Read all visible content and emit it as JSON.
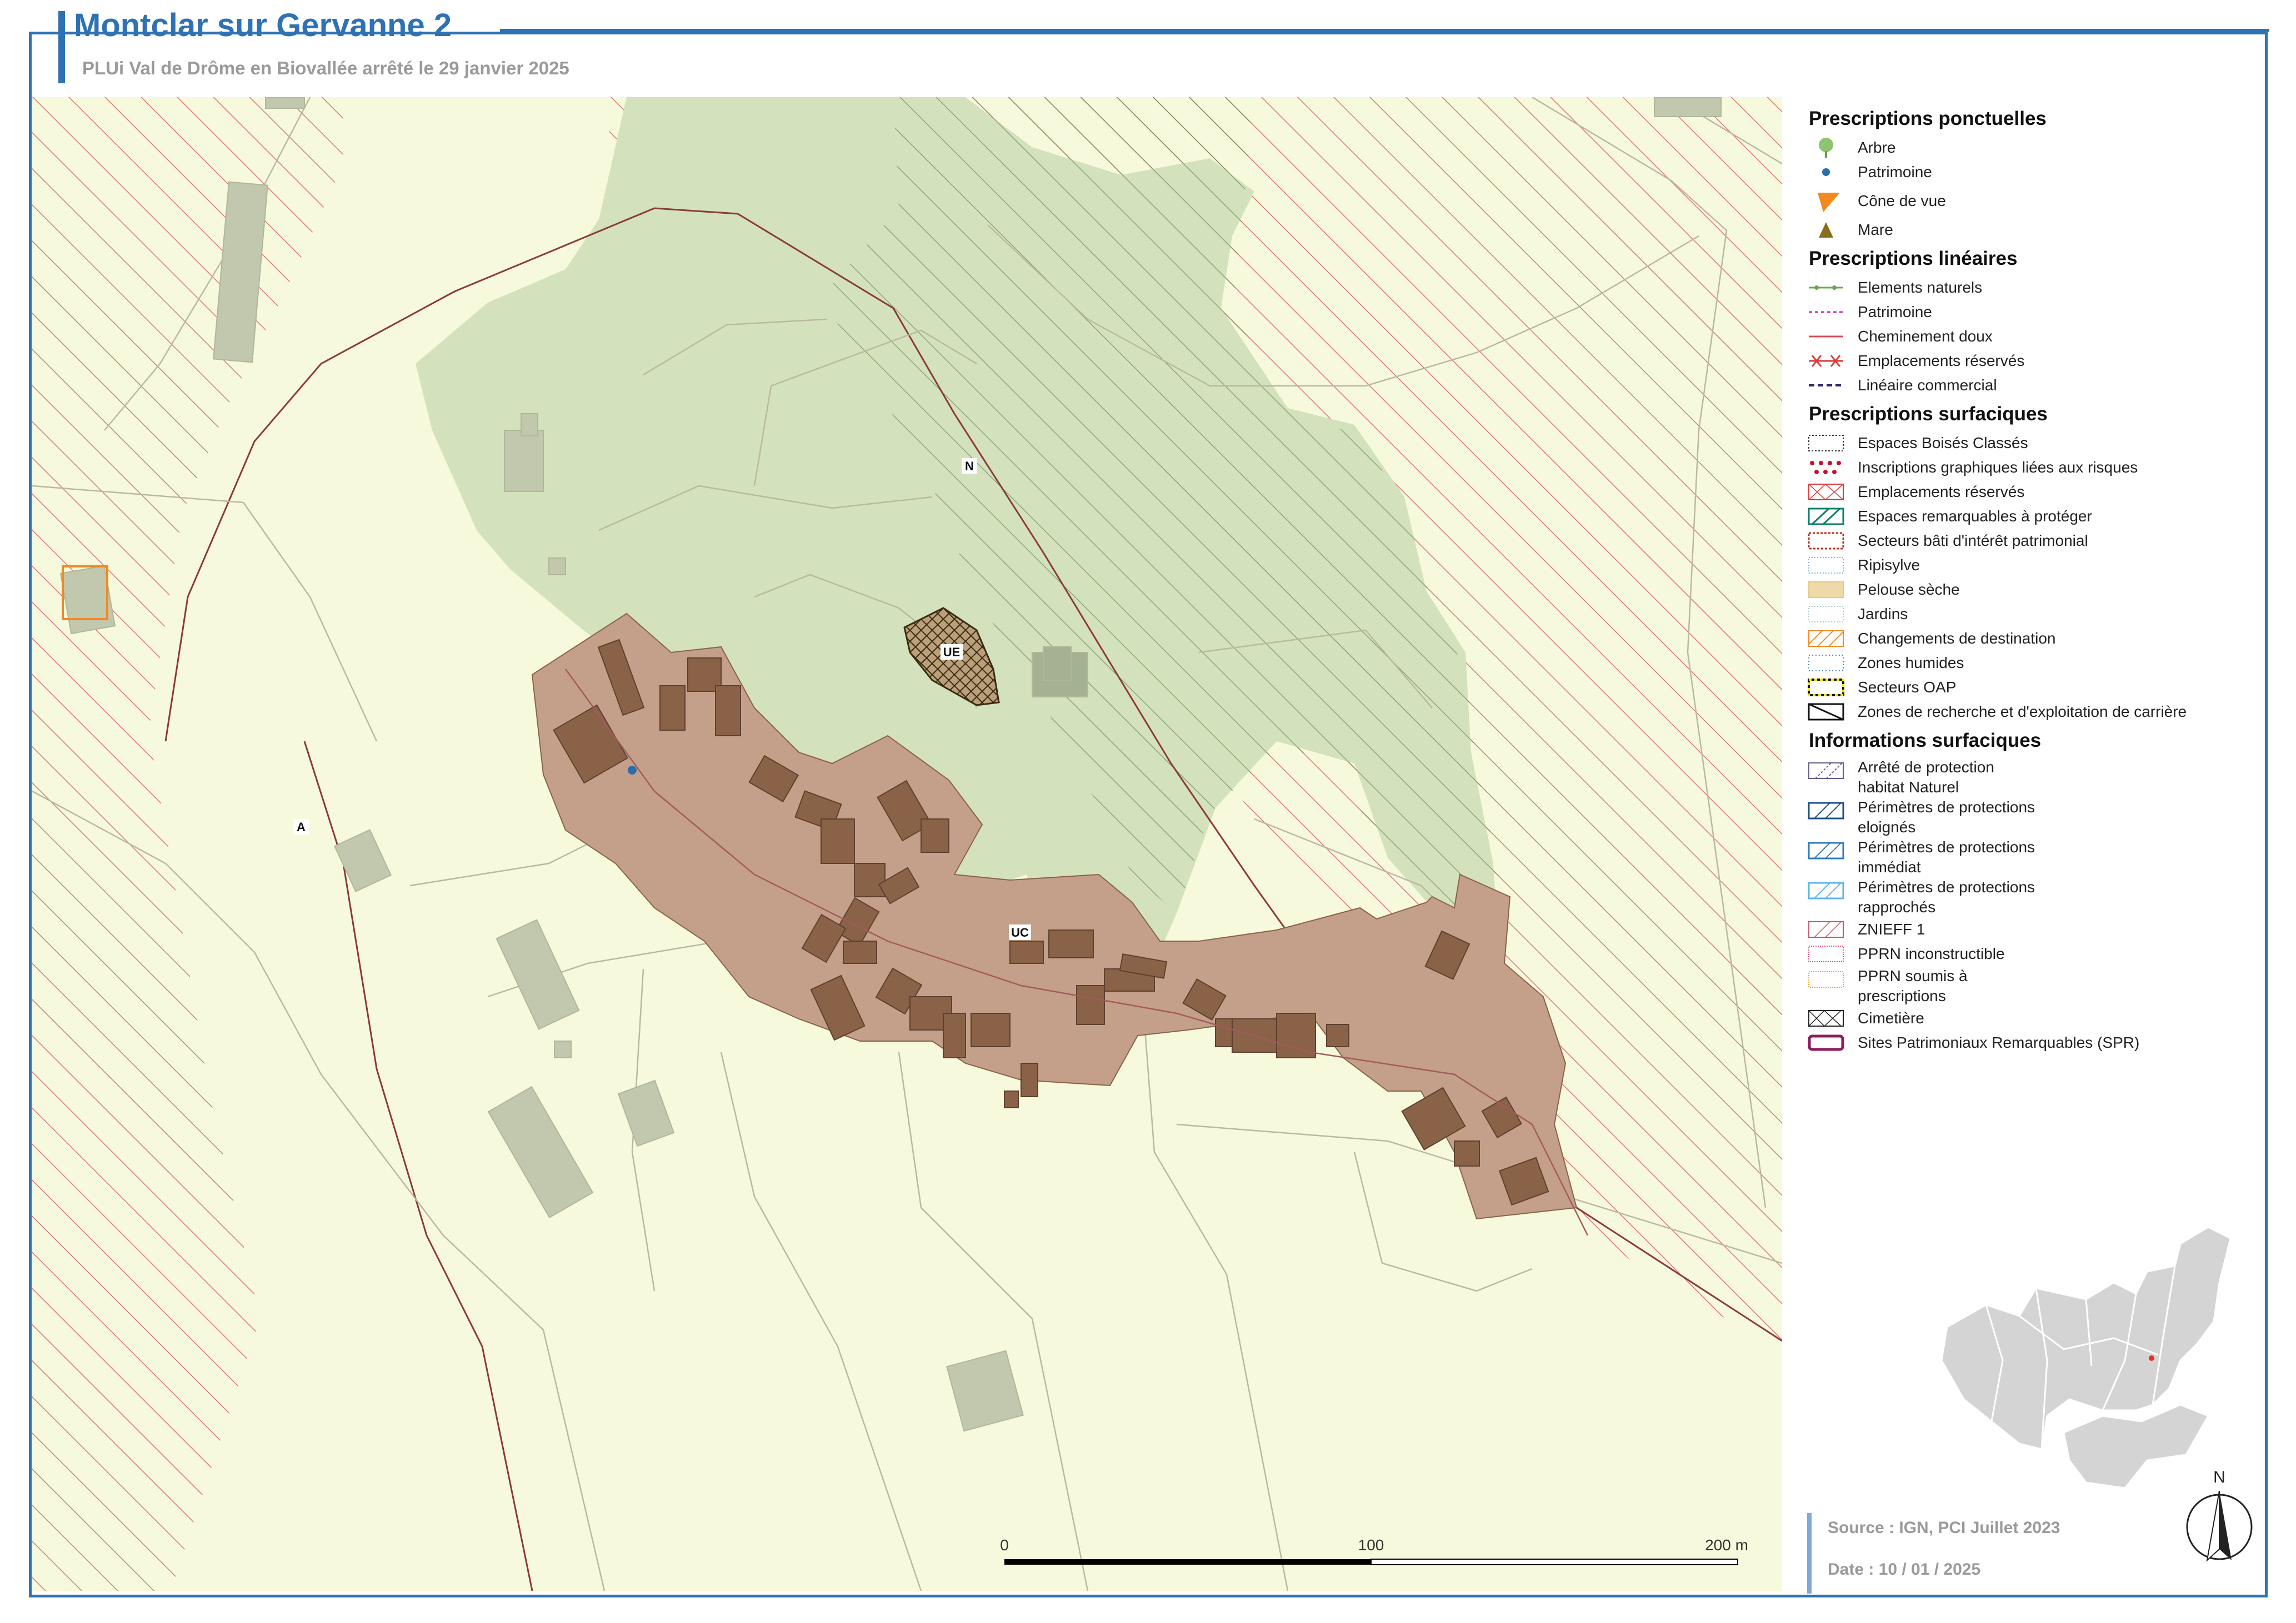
{
  "header": {
    "title": "Montclar sur Gervanne 2",
    "subtitle": "PLUi Val de Drôme en Biovallée arrêté le 29 janvier 2025"
  },
  "map": {
    "zone_labels": [
      "N",
      "UE",
      "UC",
      "A"
    ],
    "scale": {
      "labels": [
        "0",
        "100",
        "200 m"
      ]
    },
    "north_label": "N",
    "colors": {
      "agri_zone": "#f7f9dc",
      "natural_zone": "#d3e2bd",
      "urban_zone": "#bf987d",
      "building": "#8a6248",
      "hatch_red": "#c0505a",
      "hatch_green": "#5c7a4a",
      "spr_boundary": "#8b3a3a",
      "ebc_fill": "#a9c891"
    }
  },
  "legend": {
    "sections": [
      {
        "title": "Prescriptions ponctuelles",
        "items": [
          {
            "label": "Arbre",
            "icon": "tree-icon"
          },
          {
            "label": "Patrimoine",
            "icon": "patrimoine-dot-icon"
          },
          {
            "label": "Cône de vue",
            "icon": "view-cone-icon"
          },
          {
            "label": "Mare",
            "icon": "mare-triangle-icon"
          }
        ]
      },
      {
        "title": "Prescriptions linéaires",
        "items": [
          {
            "label": "Elements naturels",
            "icon": "green-dotted-line-icon"
          },
          {
            "label": "Patrimoine",
            "icon": "magenta-dashed-line-icon"
          },
          {
            "label": "Cheminement doux",
            "icon": "red-line-icon"
          },
          {
            "label": "Emplacements réservés",
            "icon": "red-cross-line-icon"
          },
          {
            "label": "Linéaire commercial",
            "icon": "navy-dashed-line-icon"
          }
        ]
      },
      {
        "title": "Prescriptions surfaciques",
        "items": [
          {
            "label": "Espaces Boisés Classés",
            "icon": "ebc-icon"
          },
          {
            "label": "Inscriptions graphiques liées aux risques",
            "icon": "risk-dots-icon"
          },
          {
            "label": "Emplacements réservés",
            "icon": "reserved-area-icon"
          },
          {
            "label": "Espaces remarquables à protéger",
            "icon": "remarkable-space-icon"
          },
          {
            "label": "Secteurs bâti d'intérêt patrimonial",
            "icon": "heritage-sector-icon"
          },
          {
            "label": "Ripisylve",
            "icon": "ripisylve-icon"
          },
          {
            "label": "Pelouse sèche",
            "icon": "dry-grass-icon"
          },
          {
            "label": "Jardins",
            "icon": "garden-icon"
          },
          {
            "label": "Changements de destination",
            "icon": "destination-change-icon"
          },
          {
            "label": "Zones humides",
            "icon": "wetland-icon"
          },
          {
            "label": "Secteurs OAP",
            "icon": "oap-icon"
          },
          {
            "label": "Zones de recherche et d'exploitation de carrière",
            "icon": "quarry-icon"
          }
        ]
      },
      {
        "title": "Informations surfaciques",
        "items": [
          {
            "label": "Arrêté de protection habitat Naturel",
            "icon": "apb-icon",
            "tall": true
          },
          {
            "label": "Périmètres de protections eloignés",
            "icon": "far-perimeter-icon",
            "tall": true
          },
          {
            "label": "Périmètres de protections immédiat",
            "icon": "immediate-perimeter-icon",
            "tall": true
          },
          {
            "label": "Périmètres de protections rapprochés",
            "icon": "close-perimeter-icon",
            "tall": true
          },
          {
            "label": "ZNIEFF 1",
            "icon": "znieff-icon"
          },
          {
            "label": "PPRN inconstructible",
            "icon": "pprn-red-icon"
          },
          {
            "label": "PPRN soumis à prescriptions",
            "icon": "pprn-orange-icon",
            "tall": true
          },
          {
            "label": "Cimetière",
            "icon": "cemetery-icon"
          },
          {
            "label": "Sites Patrimoniaux Remarquables (SPR)",
            "icon": "spr-icon"
          }
        ]
      }
    ]
  },
  "footer": {
    "source": "Source : IGN, PCI Juillet 2023",
    "date": "Date : 10 / 01 / 2025"
  }
}
